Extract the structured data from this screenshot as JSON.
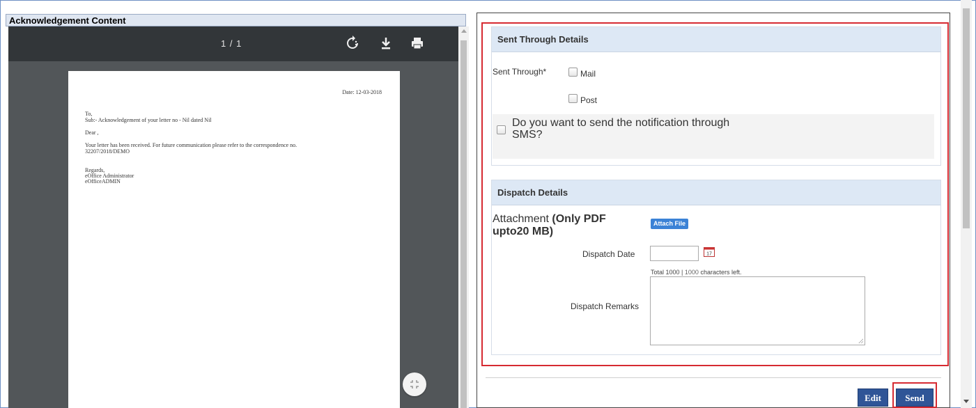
{
  "left_panel": {
    "title": "Acknowledgement Content",
    "pdf_toolbar": {
      "page_counter": "1 / 1",
      "rotate_icon": "rotate-icon",
      "download_icon": "download-icon",
      "print_icon": "print-icon"
    },
    "pdf_page": {
      "date": "Date: 12-03-2018",
      "to": "To,",
      "subject": "Sub:- Acknowledgement of your letter no - Nil dated Nil",
      "salutation": "Dear ,",
      "body_line1": "Your letter has been received. For future communication please refer to the correspondence no.",
      "body_line2": "32207/2018/DEMO",
      "regards": "Regards,",
      "sign1": "eOffice Administrator",
      "sign2": "eOfficeADMIN"
    },
    "fit_button_icon": "fit-to-page-icon"
  },
  "sent_through": {
    "header": "Sent Through Details",
    "label": "Sent Through*",
    "options": [
      "Mail",
      "Post"
    ],
    "sms_question": "Do you want to send the notification through SMS?"
  },
  "dispatch": {
    "header": "Dispatch Details",
    "attachment_label": "Attachment",
    "attachment_note": "(Only PDF upto20 MB)",
    "attach_button": "Attach File",
    "date_label": "Dispatch Date",
    "calendar_icon": "calendar-icon",
    "calendar_day": "17",
    "chars_total": "Total 1000 |",
    "chars_left_value": "1000",
    "chars_left_suffix": "characters left.",
    "remarks_label": "Dispatch Remarks"
  },
  "footer": {
    "edit_label": "Edit",
    "send_label": "Send"
  },
  "colors": {
    "highlight_red": "#d62a31",
    "section_header_bg": "#dde8f5",
    "button_blue": "#2f5597",
    "pdf_toolbar": "#323639"
  }
}
